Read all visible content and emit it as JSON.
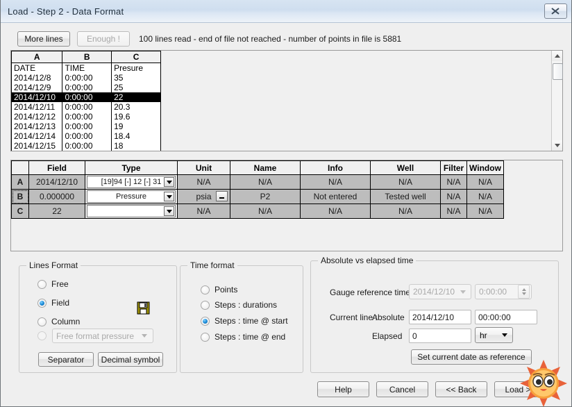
{
  "window": {
    "title": "Load - Step 2 - Data Format",
    "close_icon": "close-icon"
  },
  "toolbar": {
    "more_lines_label": "More lines",
    "enough_label": "Enough !",
    "status_text": "100 lines read - end of file not reached - number of points in file is 5881"
  },
  "preview": {
    "columns": [
      "A",
      "B",
      "C"
    ],
    "rows": [
      {
        "a": "DATE",
        "b": "TIME",
        "c": "Presure",
        "selected": false
      },
      {
        "a": "2014/12/8",
        "b": "0:00:00",
        "c": "35",
        "selected": false
      },
      {
        "a": "2014/12/9",
        "b": "0:00:00",
        "c": "25",
        "selected": false
      },
      {
        "a": "2014/12/10",
        "b": "0:00:00",
        "c": "22",
        "selected": true
      },
      {
        "a": "2014/12/11",
        "b": "0:00:00",
        "c": "20.3",
        "selected": false
      },
      {
        "a": "2014/12/12",
        "b": "0:00:00",
        "c": "19.6",
        "selected": false
      },
      {
        "a": "2014/12/13",
        "b": "0:00:00",
        "c": "19",
        "selected": false
      },
      {
        "a": "2014/12/14",
        "b": "0:00:00",
        "c": "18.4",
        "selected": false
      },
      {
        "a": "2014/12/15",
        "b": "0:00:00",
        "c": "18",
        "selected": false
      }
    ]
  },
  "fields": {
    "headers": [
      "",
      "Field",
      "Type",
      "Unit",
      "Name",
      "Info",
      "Well",
      "Filter",
      "Window"
    ],
    "rows": [
      {
        "id": "A",
        "id_green": true,
        "field": "2014/12/10",
        "type": "[19]94 [-] 12 [-] 31",
        "unit": "N/A",
        "name": "N/A",
        "info": "N/A",
        "well": "N/A",
        "filter": "N/A",
        "window": "N/A"
      },
      {
        "id": "B",
        "id_green": true,
        "field": "0.000000",
        "type": "Pressure",
        "unit": "psia",
        "name": "P2",
        "info": "Not entered",
        "well": "Tested well",
        "filter": "N/A",
        "window": "N/A"
      },
      {
        "id": "C",
        "id_green": false,
        "field": "22",
        "type": "",
        "unit": "N/A",
        "name": "N/A",
        "info": "N/A",
        "well": "N/A",
        "filter": "N/A",
        "window": "N/A"
      }
    ]
  },
  "lines_format": {
    "legend": "Lines Format",
    "options": [
      {
        "label": "Free",
        "selected": false,
        "disabled": false
      },
      {
        "label": "Field",
        "selected": true,
        "disabled": false
      },
      {
        "label": "Column",
        "selected": false,
        "disabled": false
      }
    ],
    "custom_option_selected": false,
    "custom_combo_value": "Free format pressure",
    "save_icon": "floppy-disk-save-icon",
    "separator_label": "Separator",
    "decimal_symbol_label": "Decimal symbol"
  },
  "time_format": {
    "legend": "Time format",
    "options": [
      {
        "label": "Points",
        "selected": false
      },
      {
        "label": "Steps : durations",
        "selected": false
      },
      {
        "label": "Steps : time @ start",
        "selected": true
      },
      {
        "label": "Steps : time @ end",
        "selected": false
      }
    ]
  },
  "absolute_elapsed": {
    "legend": "Absolute vs elapsed time",
    "gauge_reference_label": "Gauge reference time",
    "gauge_reference_date": "2014/12/10",
    "gauge_reference_time": "0:00:00",
    "current_line_label": "Current line :",
    "absolute_label": "Absolute",
    "absolute_date": "2014/12/10",
    "absolute_time": "00:00:00",
    "elapsed_label": "Elapsed",
    "elapsed_value": "0",
    "elapsed_unit": "hr",
    "set_reference_label": "Set current date as reference"
  },
  "footer": {
    "help_label": "Help",
    "cancel_label": "Cancel",
    "back_label": "<< Back",
    "load_label": "Load >>"
  },
  "decor": {
    "cursor_icon": "sun-face-cursor-icon"
  }
}
